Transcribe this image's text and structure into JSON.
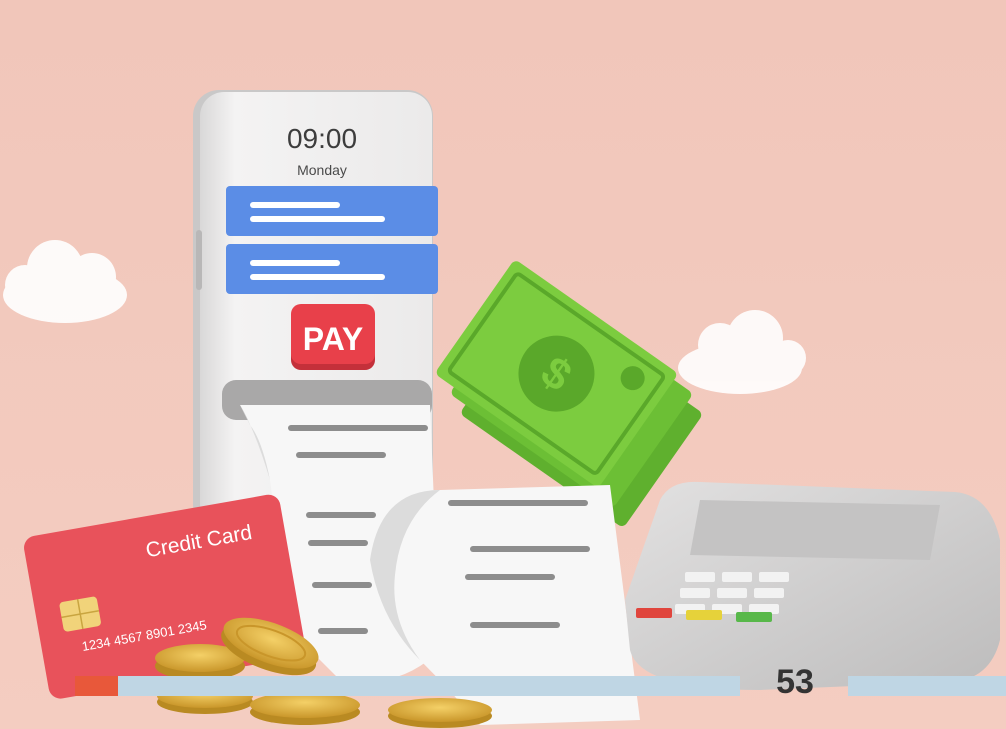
{
  "phone": {
    "time": "09:00",
    "day": "Monday",
    "pay_label": "PAY"
  },
  "card": {
    "title": "Credit Card",
    "number": "1234 4567 8901 2345"
  },
  "footer": {
    "page_number": "53"
  },
  "colors": {
    "background": "#f3c9bd",
    "phone_body": "#efeeee",
    "blue_bar": "#5b8de6",
    "pay_button": "#e8404a",
    "card": "#e8525b",
    "money": "#7ccc3f",
    "coin": "#e0b43a",
    "terminal": "#d7d6d6",
    "footer_orange": "#e8583a",
    "footer_blue": "#bfd6e4",
    "page_number_text": "#333333"
  }
}
